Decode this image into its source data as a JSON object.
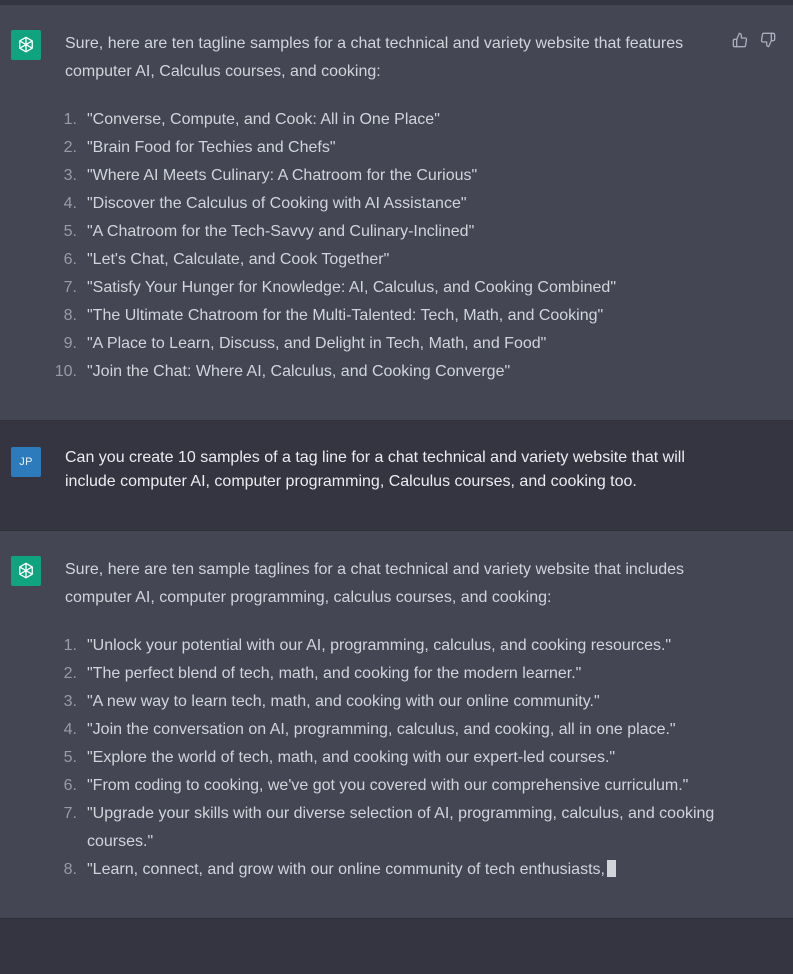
{
  "message1": {
    "intro": "Sure, here are ten tagline samples for a chat technical and variety website that features computer AI, Calculus courses, and cooking:",
    "items": [
      {
        "num": "1.",
        "text": "\"Converse, Compute, and Cook: All in One Place\""
      },
      {
        "num": "2.",
        "text": "\"Brain Food for Techies and Chefs\""
      },
      {
        "num": "3.",
        "text": "\"Where AI Meets Culinary: A Chatroom for the Curious\""
      },
      {
        "num": "4.",
        "text": "\"Discover the Calculus of Cooking with AI Assistance\""
      },
      {
        "num": "5.",
        "text": "\"A Chatroom for the Tech-Savvy and Culinary-Inclined\""
      },
      {
        "num": "6.",
        "text": "\"Let's Chat, Calculate, and Cook Together\""
      },
      {
        "num": "7.",
        "text": "\"Satisfy Your Hunger for Knowledge: AI, Calculus, and Cooking Combined\""
      },
      {
        "num": "8.",
        "text": "\"The Ultimate Chatroom for the Multi-Talented: Tech, Math, and Cooking\""
      },
      {
        "num": "9.",
        "text": "\"A Place to Learn, Discuss, and Delight in Tech, Math, and Food\""
      },
      {
        "num": "10.",
        "text": "\"Join the Chat: Where AI, Calculus, and Cooking Converge\""
      }
    ]
  },
  "user_message": {
    "avatar": "JP",
    "text": "Can you create 10 samples of a tag line for a chat technical and variety website that will include computer AI, computer programming,  Calculus courses, and cooking too."
  },
  "message2": {
    "intro": "Sure, here are ten sample taglines for a chat technical and variety website that includes computer AI, computer programming, calculus courses, and cooking:",
    "items": [
      {
        "num": "1.",
        "text": "\"Unlock your potential with our AI, programming, calculus, and cooking resources.\""
      },
      {
        "num": "2.",
        "text": "\"The perfect blend of tech, math, and cooking for the modern learner.\""
      },
      {
        "num": "3.",
        "text": "\"A new way to learn tech, math, and cooking with our online community.\""
      },
      {
        "num": "4.",
        "text": "\"Join the conversation on AI, programming, calculus, and cooking, all in one place.\""
      },
      {
        "num": "5.",
        "text": "\"Explore the world of tech, math, and cooking with our expert-led courses.\""
      },
      {
        "num": "6.",
        "text": "\"From coding to cooking, we've got you covered with our comprehensive curriculum.\""
      },
      {
        "num": "7.",
        "text": "\"Upgrade your skills with our diverse selection of AI, programming, calculus, and cooking courses.\""
      },
      {
        "num": "8.",
        "text": "\"Learn, connect, and grow with our online community of tech enthusiasts,"
      }
    ]
  },
  "icons": {
    "assistant_avatar": "openai-logo-icon",
    "thumbs_up": "thumbs-up-icon",
    "thumbs_down": "thumbs-down-icon"
  },
  "colors": {
    "assistant_bg": "#444654",
    "user_bg": "#343541",
    "gpt_avatar": "#10a37f",
    "user_avatar": "#2d7bbd"
  }
}
